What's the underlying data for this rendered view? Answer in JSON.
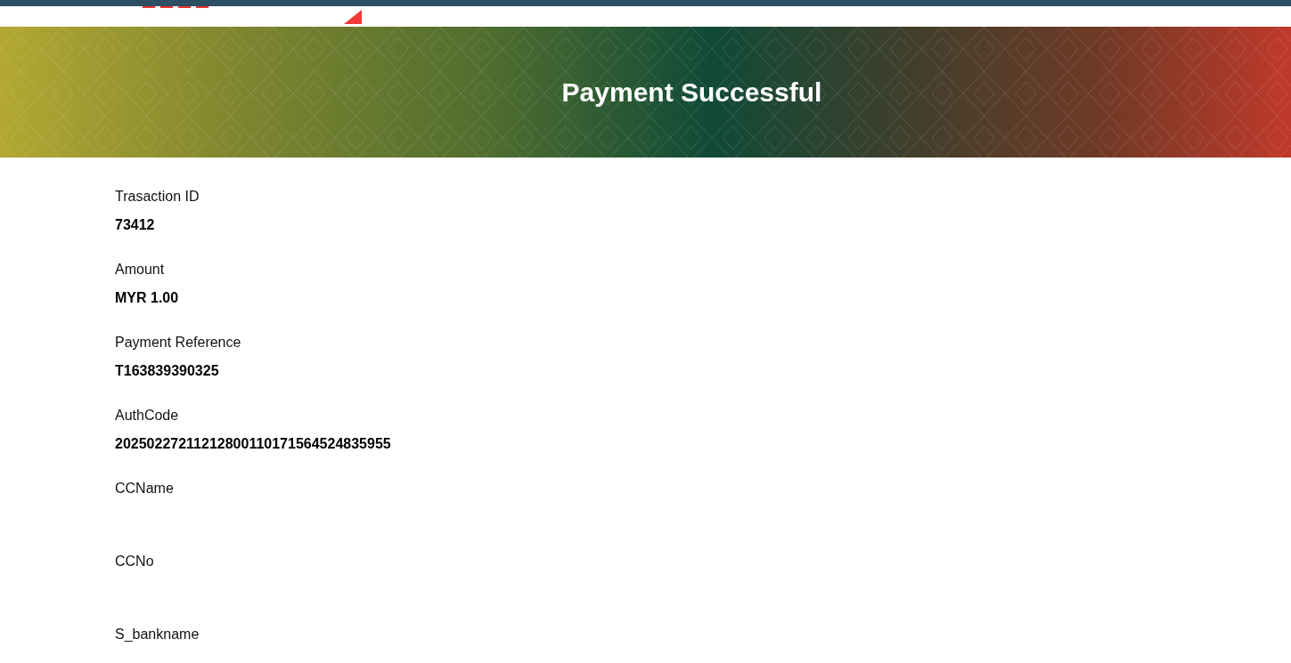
{
  "banner": {
    "title": "Payment Successful"
  },
  "fields": [
    {
      "label": "Trasaction ID",
      "value": "73412"
    },
    {
      "label": "Amount",
      "value": "MYR 1.00"
    },
    {
      "label": "Payment Reference",
      "value": "T163839390325"
    },
    {
      "label": "AuthCode",
      "value": "20250227211212800110171564524835955"
    },
    {
      "label": "CCName"
    },
    {
      "label": "CCNo"
    },
    {
      "label": "S_bankname"
    }
  ]
}
